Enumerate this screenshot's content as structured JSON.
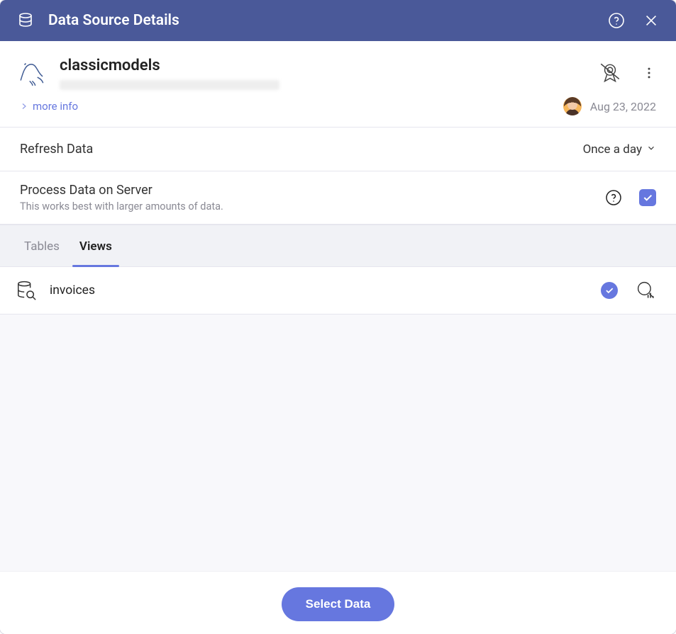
{
  "header": {
    "title": "Data Source Details"
  },
  "source": {
    "name": "classicmodels"
  },
  "moreInfo": {
    "label": "more info"
  },
  "meta": {
    "date": "Aug 23, 2022"
  },
  "settings": {
    "refresh": {
      "label": "Refresh Data",
      "value": "Once a day"
    },
    "process": {
      "label": "Process Data on Server",
      "sub": "This works best with larger amounts of data.",
      "checked": true
    }
  },
  "tabs": {
    "items": [
      "Tables",
      "Views"
    ],
    "activeIndex": 1
  },
  "views": {
    "items": [
      {
        "name": "invoices",
        "selected": true
      }
    ]
  },
  "footer": {
    "primary": "Select Data"
  },
  "colors": {
    "accent": "#6677df",
    "headerBg": "#4a5999"
  }
}
